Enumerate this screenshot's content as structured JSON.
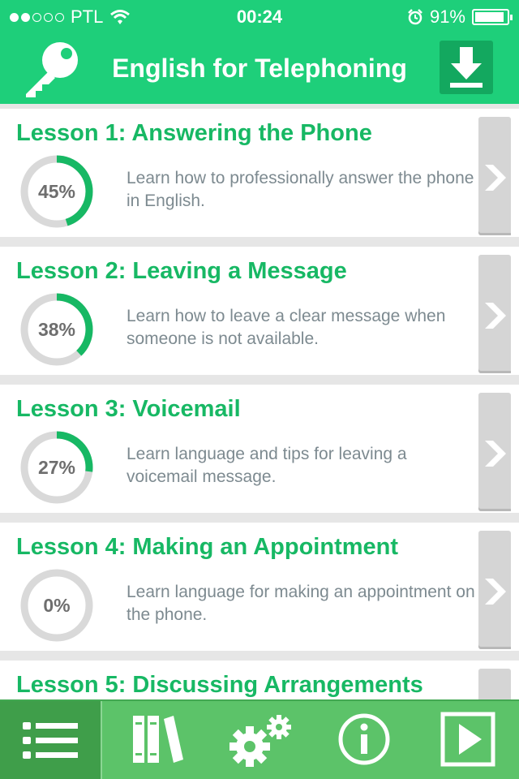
{
  "status_bar": {
    "carrier": "PTL",
    "time": "00:24",
    "battery_percent": "91%",
    "battery_level": 0.91,
    "signal_bars_filled": 2,
    "signal_bars_total": 5,
    "icons": [
      "wifi-icon",
      "alarm-icon",
      "battery-icon"
    ]
  },
  "header": {
    "title": "English for Telephoning",
    "left_icon": "key-icon",
    "right_icon": "download-icon"
  },
  "lessons": [
    {
      "title": "Lesson 1: Answering the Phone",
      "progress": 45,
      "progress_label": "45%",
      "description": "Learn how to professionally answer the phone in English."
    },
    {
      "title": "Lesson 2: Leaving a Message",
      "progress": 38,
      "progress_label": "38%",
      "description": "Learn how to leave a clear message when someone is not available."
    },
    {
      "title": "Lesson 3: Voicemail",
      "progress": 27,
      "progress_label": "27%",
      "description": "Learn language and tips for leaving a voicemail message."
    },
    {
      "title": "Lesson 4: Making an Appointment",
      "progress": 0,
      "progress_label": "0%",
      "description": "Learn language for making an appointment on the phone."
    },
    {
      "title": "Lesson 5: Discussing Arrangements",
      "progress": null,
      "progress_label": "",
      "description": ""
    }
  ],
  "toolbar": {
    "items": [
      "list-icon",
      "books-icon",
      "gears-icon",
      "info-icon",
      "play-icon"
    ],
    "active": "list-icon"
  },
  "colors": {
    "brand_green": "#1ecf7a",
    "title_green": "#17b864",
    "toolbar_green": "#5cc369",
    "progress_track": "#d9d9d9"
  }
}
